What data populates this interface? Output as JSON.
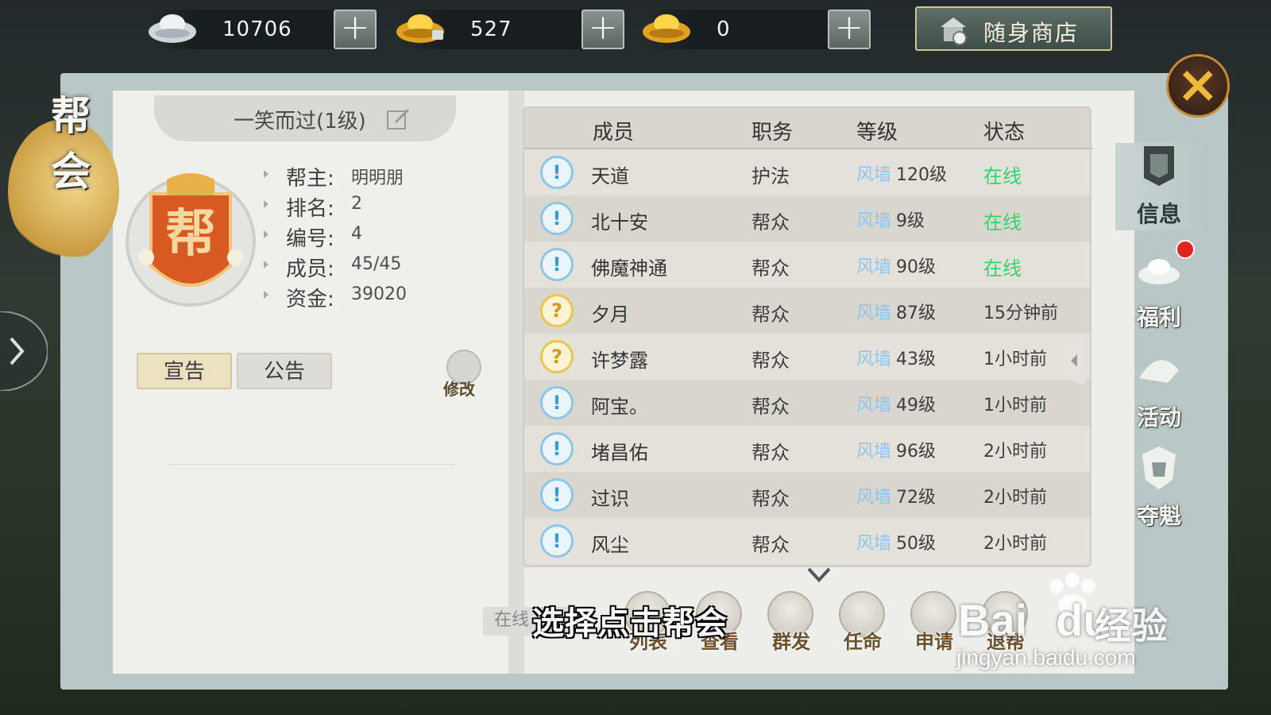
{
  "currency": {
    "silver": {
      "value": "10706",
      "icon": "silver-ingot-icon"
    },
    "gold": {
      "value": "527",
      "icon": "gold-ingot-locked-icon"
    },
    "yuanbao": {
      "value": "0",
      "icon": "gold-ingot-icon"
    },
    "plus_label": "+",
    "shop_label": "随身商店"
  },
  "side_title": [
    "帮",
    "会"
  ],
  "guild": {
    "name": "一笑而过(1级)",
    "emblem_char": "帮",
    "info": [
      {
        "key": "帮主:",
        "value": "明明朋"
      },
      {
        "key": "排名:",
        "value": "2"
      },
      {
        "key": "编号:",
        "value": "4"
      },
      {
        "key": "成员:",
        "value": "45/45"
      },
      {
        "key": "资金:",
        "value": "39020"
      }
    ],
    "tabs": [
      "宣告",
      "公告"
    ],
    "modify_label": "修改"
  },
  "members": {
    "headers": [
      "成员",
      "职务",
      "等级",
      "状态"
    ],
    "level_prefix": "风墙",
    "rows": [
      {
        "badge": "!",
        "badge_type": "blue",
        "name": "天道",
        "role": "护法",
        "level": "120级",
        "status": "在线",
        "online": true
      },
      {
        "badge": "!",
        "badge_type": "blue",
        "name": "北十安",
        "role": "帮众",
        "level": "9级",
        "status": "在线",
        "online": true
      },
      {
        "badge": "!",
        "badge_type": "blue",
        "name": "佛魔神通",
        "role": "帮众",
        "level": "90级",
        "status": "在线",
        "online": true
      },
      {
        "badge": "?",
        "badge_type": "gold",
        "name": "夕月",
        "role": "帮众",
        "level": "87级",
        "status": "15分钟前",
        "online": false
      },
      {
        "badge": "?",
        "badge_type": "gold",
        "name": "许梦露",
        "role": "帮众",
        "level": "43级",
        "status": "1小时前",
        "online": false
      },
      {
        "badge": "!",
        "badge_type": "blue",
        "name": "阿宝。",
        "role": "帮众",
        "level": "49级",
        "status": "1小时前",
        "online": false
      },
      {
        "badge": "!",
        "badge_type": "blue",
        "name": "堵昌佑",
        "role": "帮众",
        "level": "96级",
        "status": "2小时前",
        "online": false
      },
      {
        "badge": "!",
        "badge_type": "blue",
        "name": "过识",
        "role": "帮众",
        "level": "72级",
        "status": "2小时前",
        "online": false
      },
      {
        "badge": "!",
        "badge_type": "blue",
        "name": "风尘",
        "role": "帮众",
        "level": "50级",
        "status": "2小时前",
        "online": false
      }
    ]
  },
  "bottom": {
    "online_chip": "在线",
    "actions": [
      "列表",
      "查看",
      "群发",
      "任命",
      "申请",
      "退帮"
    ]
  },
  "right_tabs": [
    "信息",
    "福利",
    "活动",
    "夺魁"
  ],
  "close_label": "×",
  "subtitle": "选择点击帮会",
  "watermark": {
    "brand": "Bai",
    "brand_du": "du",
    "brand2": "经验",
    "url": "jingyan.baidu.com"
  },
  "colors": {
    "online": "#35d36b",
    "level_prefix": "#8fc5ee",
    "accent_gold": "#f0b83c",
    "alert": "#e3241c"
  }
}
